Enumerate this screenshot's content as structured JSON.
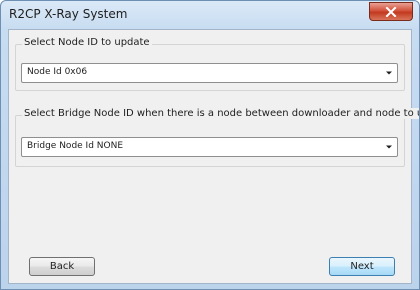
{
  "window": {
    "title": "R2CP X-Ray System",
    "close_icon": "close-x-icon"
  },
  "node_group": {
    "label": "Select Node ID to update",
    "selected_value": "Node Id 0x06",
    "arrow_icon": "chevron-down-icon"
  },
  "bridge_group": {
    "label": "Select Bridge Node ID when there is a node between downloader and node to update",
    "selected_value": "Bridge Node Id NONE",
    "arrow_icon": "chevron-down-icon"
  },
  "buttons": {
    "back_label": "Back",
    "next_label": "Next"
  },
  "colors": {
    "frame": "#bcd3ec",
    "close_button": "#c23a1f",
    "dialog_background": "#f0f0f0",
    "default_button_border": "#3c7fb1"
  }
}
